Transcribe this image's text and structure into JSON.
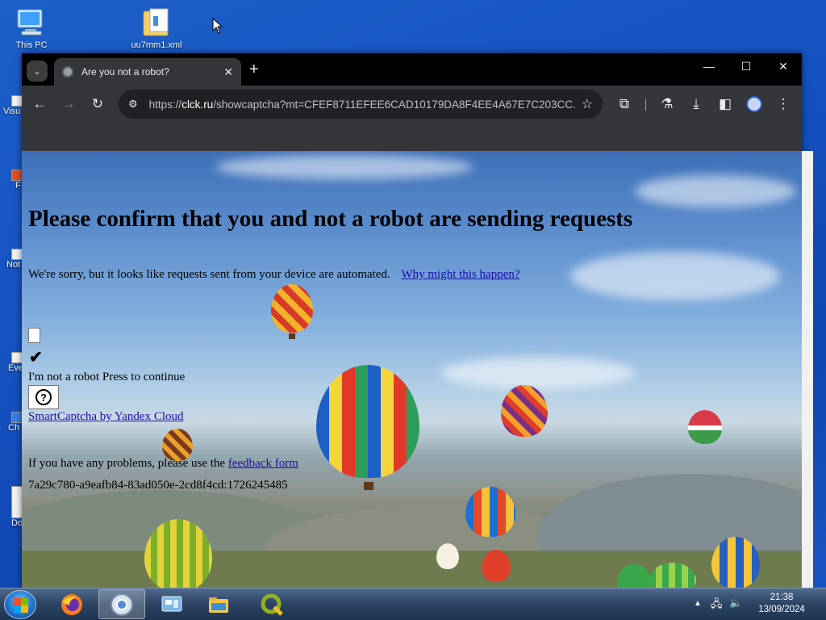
{
  "desktop": {
    "icons": [
      {
        "name": "This PC",
        "id": "this-pc"
      },
      {
        "name": "uu7mm1.xml",
        "id": "folder"
      }
    ],
    "left_labels": [
      "Visu",
      "F",
      "Not",
      "Eve",
      "Ch",
      "Do"
    ]
  },
  "browser": {
    "tab": {
      "title": "Are you not a robot?"
    },
    "new_tab_label": "+",
    "controls": {
      "minimize": "—",
      "maximize": "☐",
      "close": "✕"
    },
    "address": {
      "prefix": "https://",
      "host": "clck.ru",
      "path": "/showcaptcha?mt=CFEF8711EFEE6CAD10179DA8F4EE4A67E7C203CC..."
    }
  },
  "page": {
    "title": "Please confirm that you and not a robot are sending requests",
    "sorry_text": "We're sorry, but it looks like requests sent from your device are automated.",
    "why_link": "Why might this happen?",
    "check_mark": "✔",
    "robot_text": "I'm not a robot Press to continue",
    "help_symbol": "?",
    "smartcaptcha_link": "SmartCaptcha by Yandex Cloud",
    "feedback_prefix": "If you have any problems, please use the",
    "feedback_link": "feedback form",
    "request_id": "7a29c780-a9eafb84-83ad050e-2cd8f4cd:1726245485"
  },
  "taskbar": {
    "apps": [
      "firefox",
      "chrome",
      "control-panel",
      "file-explorer",
      "qgis"
    ],
    "active_app": "chrome",
    "time": "21:38",
    "date": "13/09/2024"
  }
}
